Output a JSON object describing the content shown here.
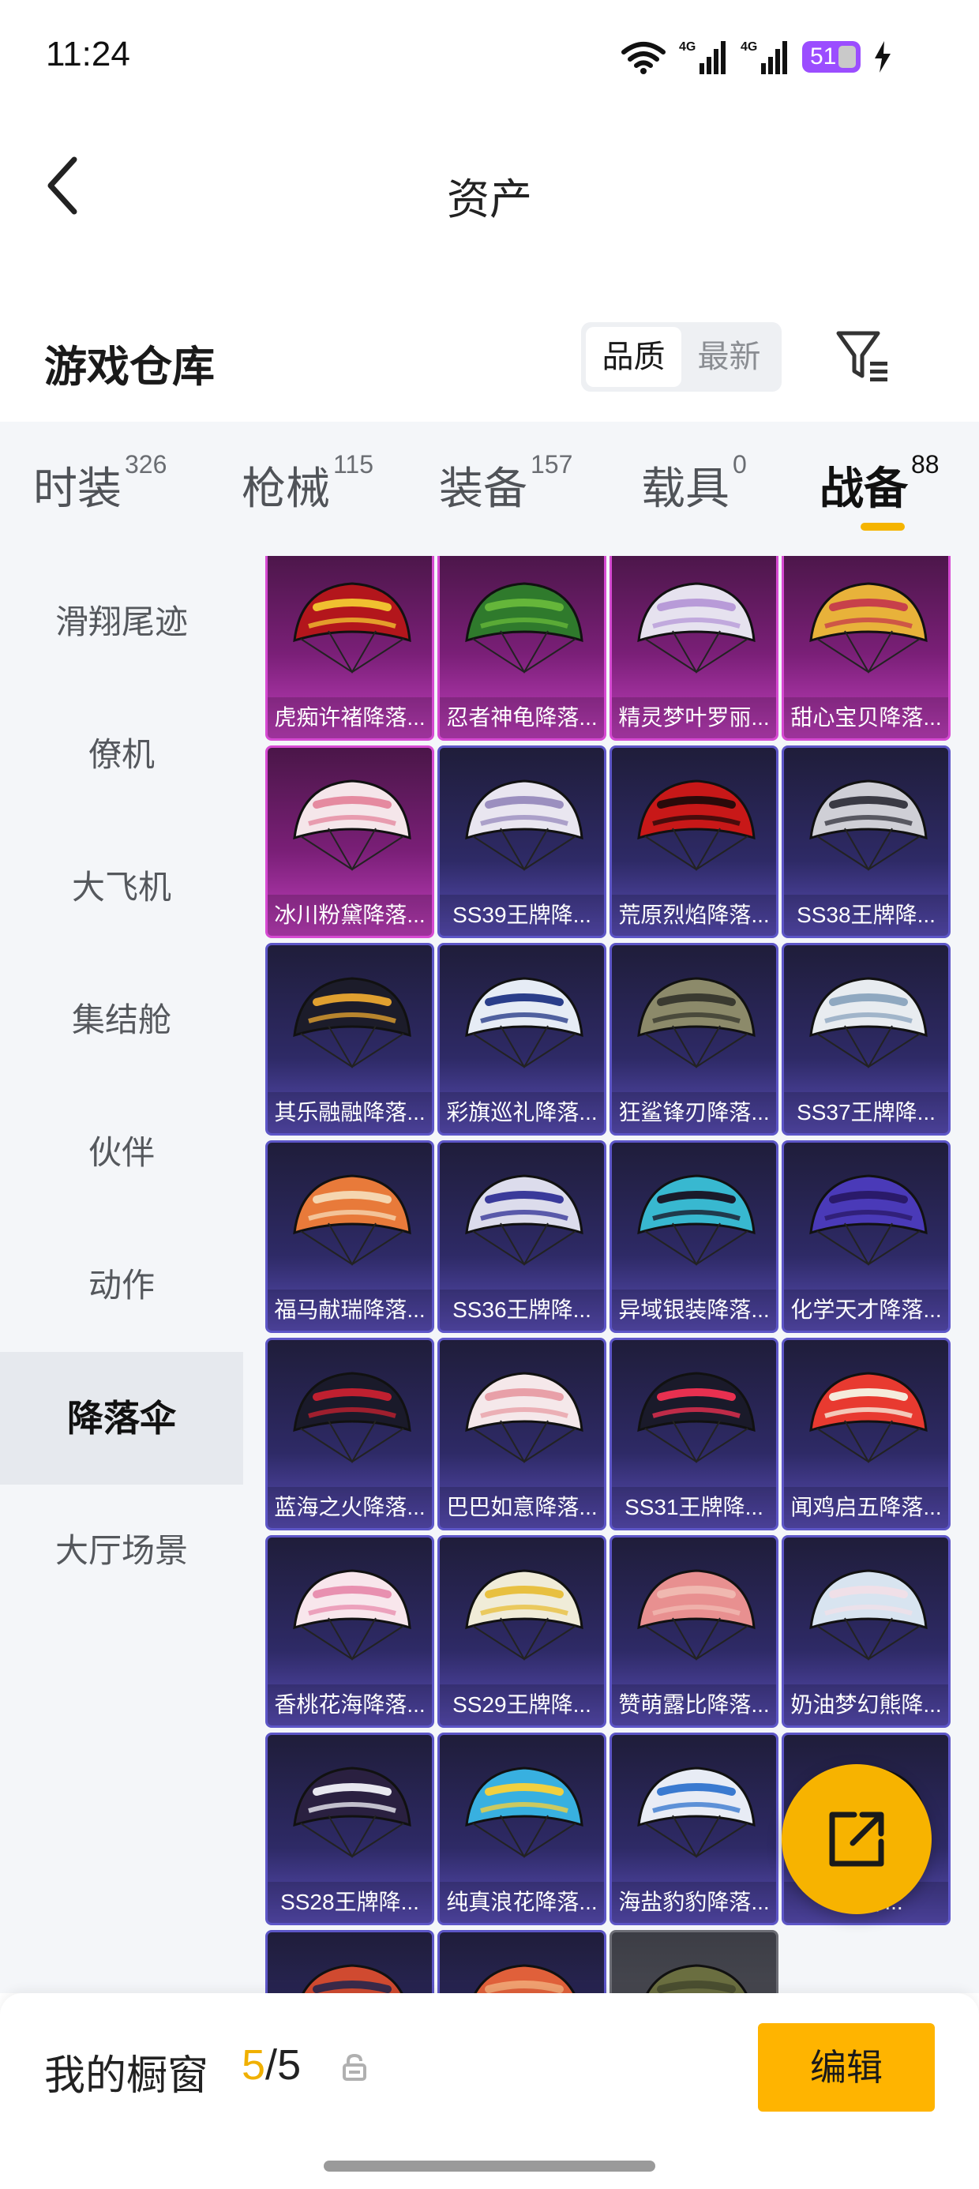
{
  "status_bar": {
    "time": "11:24",
    "battery": "51",
    "net1": "4G",
    "net2": "4G"
  },
  "nav": {
    "title": "资产"
  },
  "header": {
    "title": "游戏仓库",
    "sort_options": [
      "品质",
      "最新"
    ],
    "sort_active": 0
  },
  "tabs": [
    {
      "label": "时装",
      "count": "326"
    },
    {
      "label": "枪械",
      "count": "115"
    },
    {
      "label": "装备",
      "count": "157"
    },
    {
      "label": "载具",
      "count": "0"
    },
    {
      "label": "战备",
      "count": "88"
    }
  ],
  "side_menu": [
    {
      "label": "滑翔尾迹"
    },
    {
      "label": "僚机"
    },
    {
      "label": "大飞机"
    },
    {
      "label": "集结舱"
    },
    {
      "label": "伙伴"
    },
    {
      "label": "动作"
    },
    {
      "label": "降落伞"
    },
    {
      "label": "大厅场景"
    }
  ],
  "items": [
    {
      "label": "虎痴许褚降落...",
      "rarity": "legendary",
      "colors": [
        "#b3161c",
        "#f0c030"
      ]
    },
    {
      "label": "忍者神龟降落...",
      "rarity": "legendary",
      "colors": [
        "#2f7a2c",
        "#65b63a"
      ]
    },
    {
      "label": "精灵梦叶罗丽...",
      "rarity": "legendary",
      "colors": [
        "#e6e2ef",
        "#b89bd8"
      ]
    },
    {
      "label": "甜心宝贝降落...",
      "rarity": "legendary",
      "colors": [
        "#e8b23a",
        "#c7404a"
      ]
    },
    {
      "label": "冰川粉黛降落...",
      "rarity": "legendary",
      "colors": [
        "#f5e6ea",
        "#e58aa0"
      ]
    },
    {
      "label": "SS39王牌降...",
      "rarity": "epic",
      "colors": [
        "#e9e6f0",
        "#9b8fbf"
      ]
    },
    {
      "label": "荒原烈焰降落...",
      "rarity": "epic",
      "colors": [
        "#c81818",
        "#2a0a0a"
      ]
    },
    {
      "label": "SS38王牌降...",
      "rarity": "epic",
      "colors": [
        "#cfcfd6",
        "#3a3a44"
      ]
    },
    {
      "label": "其乐融融降落...",
      "rarity": "epic",
      "colors": [
        "#1c1c2a",
        "#e0a030"
      ]
    },
    {
      "label": "彩旗巡礼降落...",
      "rarity": "epic",
      "colors": [
        "#e6ecf5",
        "#2a3e8a"
      ]
    },
    {
      "label": "狂鲨锋刃降落...",
      "rarity": "epic",
      "colors": [
        "#8c8a6a",
        "#3a3a30"
      ]
    },
    {
      "label": "SS37王牌降...",
      "rarity": "epic",
      "colors": [
        "#e8ecf0",
        "#8fa8c0"
      ]
    },
    {
      "label": "福马献瑞降落...",
      "rarity": "epic",
      "colors": [
        "#e87a3a",
        "#f5d6b0"
      ]
    },
    {
      "label": "SS36王牌降...",
      "rarity": "epic",
      "colors": [
        "#dcdcec",
        "#3a3a9a"
      ]
    },
    {
      "label": "异域银装降落...",
      "rarity": "epic",
      "colors": [
        "#38b8d0",
        "#1a1a2a"
      ]
    },
    {
      "label": "化学天才降落...",
      "rarity": "epic",
      "colors": [
        "#4a3ab8",
        "#2a1a6a"
      ]
    },
    {
      "label": "蓝海之火降落...",
      "rarity": "epic",
      "colors": [
        "#1a1a2a",
        "#c02030"
      ]
    },
    {
      "label": "巴巴如意降落...",
      "rarity": "epic",
      "colors": [
        "#f5e8ea",
        "#e8a0a8"
      ]
    },
    {
      "label": "SS31王牌降...",
      "rarity": "epic",
      "colors": [
        "#1a1a2a",
        "#e83050"
      ]
    },
    {
      "label": "闻鸡启五降落...",
      "rarity": "epic",
      "colors": [
        "#e83a30",
        "#f5ecdc"
      ]
    },
    {
      "label": "香桃花海降落...",
      "rarity": "epic",
      "colors": [
        "#f8e6ec",
        "#e890b0"
      ]
    },
    {
      "label": "SS29王牌降...",
      "rarity": "epic",
      "colors": [
        "#f0ecd8",
        "#e8c040"
      ]
    },
    {
      "label": "赞萌露比降落...",
      "rarity": "epic",
      "colors": [
        "#e89090",
        "#f0b8b0"
      ]
    },
    {
      "label": "奶油梦幻熊降...",
      "rarity": "epic",
      "colors": [
        "#d8e4f0",
        "#f0e0e8"
      ]
    },
    {
      "label": "SS28王牌降...",
      "rarity": "epic",
      "colors": [
        "#2a2040",
        "#e8e8f0"
      ]
    },
    {
      "label": "纯真浪花降落...",
      "rarity": "epic",
      "colors": [
        "#38b0e0",
        "#f0d040"
      ]
    },
    {
      "label": "海盐豹豹降落...",
      "rarity": "epic",
      "colors": [
        "#e8ecf5",
        "#3a7ad0"
      ]
    },
    {
      "label": "S...降...",
      "rarity": "epic",
      "colors": [
        "#e0e0ea",
        "#9090b0"
      ]
    },
    {
      "label": "",
      "rarity": "epic",
      "colors": [
        "#d04a30",
        "#3a2a4a"
      ]
    },
    {
      "label": "",
      "rarity": "epic",
      "colors": [
        "#e0603a",
        "#f0a070"
      ]
    },
    {
      "label": "",
      "rarity": "grey",
      "colors": [
        "#6a6e40",
        "#4a4e30"
      ]
    }
  ],
  "bottom": {
    "showcase_label": "我的橱窗",
    "current": "5",
    "separator": "/",
    "total": "5",
    "edit_label": "编辑"
  }
}
